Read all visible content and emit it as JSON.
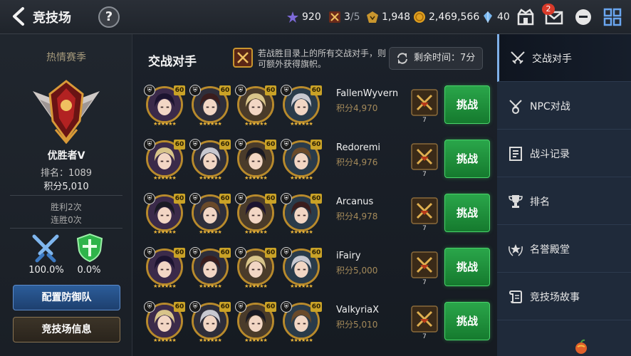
{
  "header": {
    "title": "竞技场",
    "help_label": "?",
    "resources": {
      "stamina": "920",
      "tickets": "3",
      "tickets_max": "/5",
      "honor": "1,948",
      "gold": "2,469,566",
      "crystal": "40"
    },
    "mail_badge": "2"
  },
  "left": {
    "season": "热情赛季",
    "rank_name": "优胜者V",
    "rank_position": "排名：1089",
    "points": "积分5,010",
    "wins": "胜利2次",
    "streak": "连胜0次",
    "attack_rate": "100.0%",
    "defense_rate": "0.0%",
    "defense_team_button": "配置防御队",
    "arena_info_button": "竞技场信息"
  },
  "center": {
    "title": "交战对手",
    "notice": "若战胜目录上的所有交战对手，则可额外获得旗帜。",
    "timer": "剩余时间：7分",
    "challenge_label": "挑战",
    "opponents": [
      {
        "name": "FallenWyvern",
        "points": "积分4,970",
        "flags": "7",
        "levels": [
          "60",
          "60",
          "60",
          "60"
        ]
      },
      {
        "name": "Redoremi",
        "points": "积分4,976",
        "flags": "7",
        "levels": [
          "60",
          "60",
          "60",
          "60"
        ]
      },
      {
        "name": "Arcanus",
        "points": "积分4,978",
        "flags": "7",
        "levels": [
          "60",
          "60",
          "60",
          "60"
        ]
      },
      {
        "name": "iFairy",
        "points": "积分5,000",
        "flags": "7",
        "levels": [
          "60",
          "60",
          "60",
          "60"
        ]
      },
      {
        "name": "ValkyriaX",
        "points": "积分5,010",
        "flags": "7",
        "levels": [
          "60",
          "60",
          "60",
          "60"
        ]
      }
    ]
  },
  "nav": {
    "items": [
      "交战对手",
      "NPC对战",
      "战斗记录",
      "排名",
      "名誉殿堂",
      "竞技场故事"
    ]
  },
  "colors": {
    "accent_green": "#2aa64a",
    "accent_blue": "#2c5d9a",
    "gold": "#c9a227",
    "nav_bg": "#1f2a3a"
  }
}
